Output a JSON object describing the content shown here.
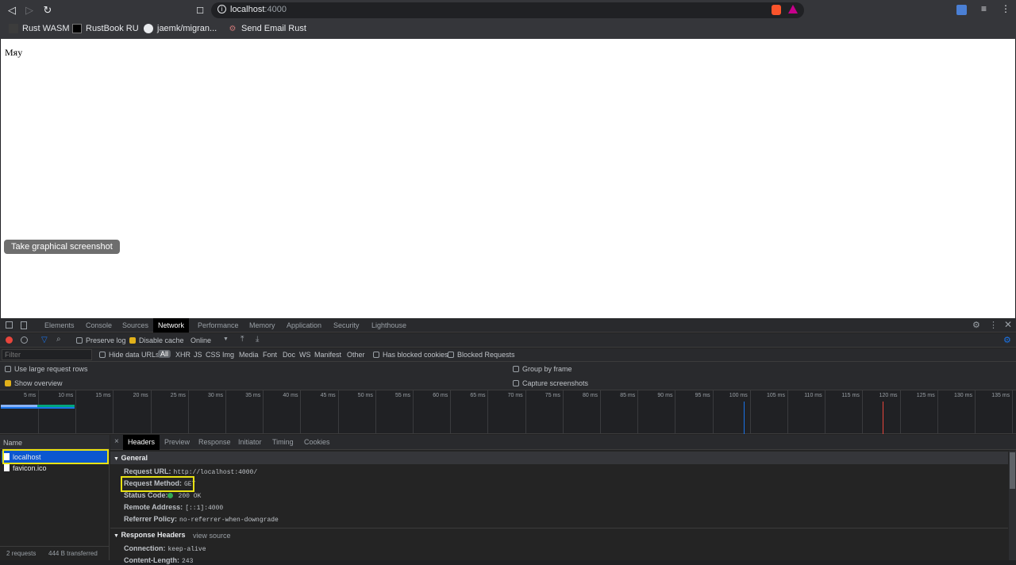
{
  "browser": {
    "url_host": "localhost",
    "url_port": ":4000",
    "bookmarks": [
      {
        "label": "Rust WASM",
        "icon": "blank-page-icon"
      },
      {
        "label": "RustBook RU",
        "icon": "book-icon"
      },
      {
        "label": "jaemk/migran...",
        "icon": "github-icon"
      },
      {
        "label": "Send Email Rust",
        "icon": "rust-icon"
      }
    ]
  },
  "page": {
    "text": "Мяу",
    "screenshot_button": "Take graphical screenshot"
  },
  "devtools": {
    "tabs": [
      "Elements",
      "Console",
      "Sources",
      "Network",
      "Performance",
      "Memory",
      "Application",
      "Security",
      "Lighthouse"
    ],
    "active_tab": "Network",
    "toolbar": {
      "preserve_log": "Preserve log",
      "disable_cache": "Disable cache",
      "throttle": "Online"
    },
    "filter": {
      "placeholder": "Filter",
      "hide_data_urls": "Hide data URLs",
      "types": [
        "All",
        "XHR",
        "JS",
        "CSS",
        "Img",
        "Media",
        "Font",
        "Doc",
        "WS",
        "Manifest",
        "Other"
      ],
      "has_blocked_cookies": "Has blocked cookies",
      "blocked_requests": "Blocked Requests"
    },
    "options": {
      "large_rows": "Use large request rows",
      "show_overview": "Show overview",
      "group_by_frame": "Group by frame",
      "capture_screenshots": "Capture screenshots"
    },
    "timeline_ticks": [
      "5 ms",
      "10 ms",
      "15 ms",
      "20 ms",
      "25 ms",
      "30 ms",
      "35 ms",
      "40 ms",
      "45 ms",
      "50 ms",
      "55 ms",
      "60 ms",
      "65 ms",
      "70 ms",
      "75 ms",
      "80 ms",
      "85 ms",
      "90 ms",
      "95 ms",
      "100 ms",
      "105 ms",
      "110 ms",
      "115 ms",
      "120 ms",
      "125 ms",
      "130 ms",
      "135 ms"
    ],
    "request_list": {
      "header": "Name",
      "rows": [
        "localhost",
        "favicon.ico"
      ],
      "footer_requests": "2 requests",
      "footer_transferred": "444 B transferred"
    },
    "detail": {
      "close": "×",
      "tabs": [
        "Headers",
        "Preview",
        "Response",
        "Initiator",
        "Timing",
        "Cookies"
      ],
      "general_title": "General",
      "general": [
        {
          "k": "Request URL:",
          "v": "http://localhost:4000/"
        },
        {
          "k": "Request Method:",
          "v": "GET"
        },
        {
          "k": "Status Code:",
          "v": "200 OK"
        },
        {
          "k": "Remote Address:",
          "v": "[::1]:4000"
        },
        {
          "k": "Referrer Policy:",
          "v": "no-referrer-when-downgrade"
        }
      ],
      "response_headers_title": "Response Headers",
      "view_source": "view source",
      "response_headers": [
        {
          "k": "Connection:",
          "v": "keep-alive"
        },
        {
          "k": "Content-Length:",
          "v": "243"
        }
      ]
    }
  }
}
